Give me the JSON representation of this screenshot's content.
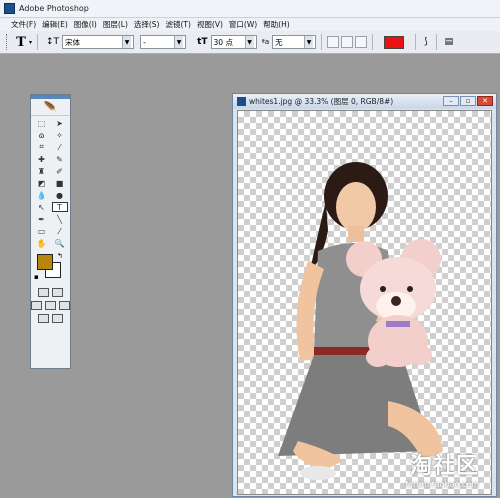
{
  "app": {
    "title": "Adobe Photoshop"
  },
  "menu": [
    "文件(F)",
    "编辑(E)",
    "图像(I)",
    "图层(L)",
    "选择(S)",
    "滤镜(T)",
    "视图(V)",
    "窗口(W)",
    "帮助(H)"
  ],
  "options": {
    "font_family": "宋体",
    "font_style": "-",
    "font_size": "30 点",
    "aa_label": "ªa",
    "aa_value": "无",
    "text_color": "#e81212"
  },
  "document": {
    "title": "whites1.jpg @ 33.3% (图层 0, RGB/8#)"
  },
  "toolbox": {
    "foreground_color": "#b8860b",
    "background_color": "#ffffff"
  },
  "watermark": {
    "main": "淘社区",
    "sub": "forum.taobao.com"
  }
}
